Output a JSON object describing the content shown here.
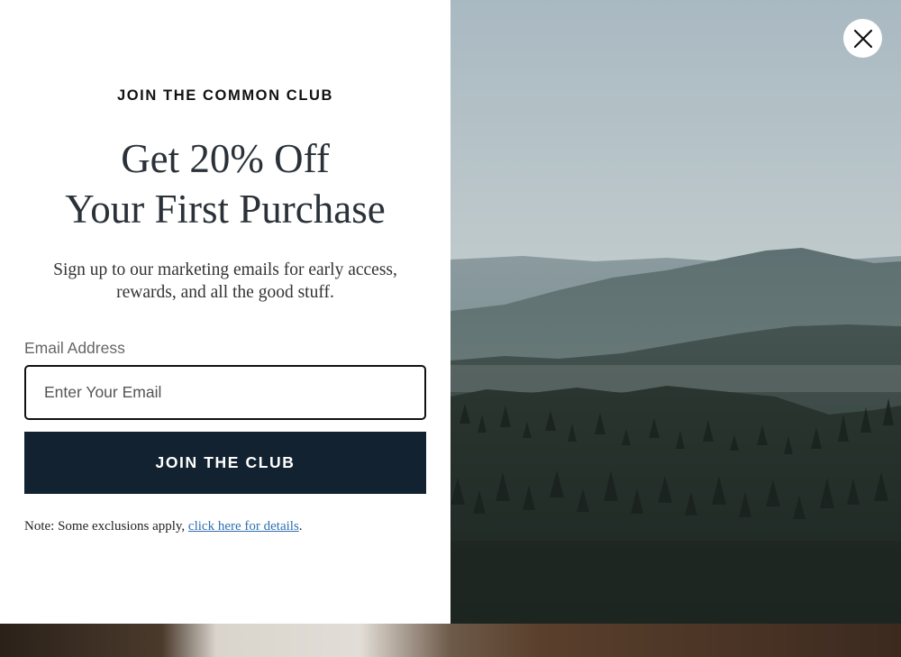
{
  "modal": {
    "eyebrow": "JOIN THE COMMON CLUB",
    "headline_line1": "Get 20% Off",
    "headline_line2": "Your First Purchase",
    "subtext_line1": "Sign up to our marketing emails for early access,",
    "subtext_line2": "rewards, and all the good stuff.",
    "email_label": "Email Address",
    "email_placeholder": "Enter Your Email",
    "email_value": "",
    "submit_label": "JOIN THE CLUB",
    "note_prefix": "Note: Some exclusions apply, ",
    "note_link": "click here for details",
    "note_suffix": "."
  },
  "close_icon": "close-icon",
  "colors": {
    "button_bg": "#132231",
    "link": "#2e6fb0",
    "headline": "#2a3138"
  }
}
